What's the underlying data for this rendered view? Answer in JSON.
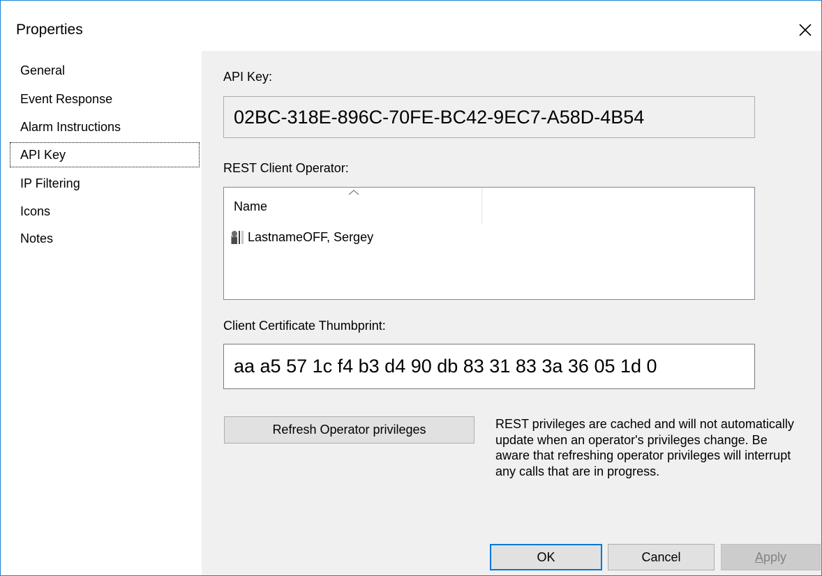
{
  "window": {
    "title": "Properties"
  },
  "sidebar": {
    "items": [
      {
        "label": "General"
      },
      {
        "label": "Event Response"
      },
      {
        "label": "Alarm Instructions"
      },
      {
        "label": "API Key",
        "selected": true
      },
      {
        "label": "IP Filtering"
      },
      {
        "label": "Icons"
      },
      {
        "label": "Notes"
      }
    ]
  },
  "api_key": {
    "label": "API Key:",
    "value": "02BC-318E-896C-70FE-BC42-9EC7-A58D-4B54"
  },
  "rest_client": {
    "label": "REST Client Operator:",
    "column_header": "Name",
    "rows": [
      {
        "name": "LastnameOFF, Sergey",
        "icon": "user-icon"
      }
    ]
  },
  "thumbprint": {
    "label": "Client Certificate Thumbprint:",
    "value": "aa a5 57 1c f4 b3 d4 90 db 83 31 83 3a 36 05 1d 0"
  },
  "refresh": {
    "button_label": "Refresh Operator privileges",
    "note": "REST privileges are cached and will not automatically update when an operator's privileges change. Be aware that refreshing operator privileges will interrupt any calls that are in progress."
  },
  "footer": {
    "ok_label": "OK",
    "cancel_label": "Cancel",
    "apply_label_first": "A",
    "apply_label_rest": "pply"
  },
  "colors": {
    "window_border": "#1883d7",
    "default_button_border": "#0078d7",
    "dialog_background": "#f0f0f0"
  }
}
